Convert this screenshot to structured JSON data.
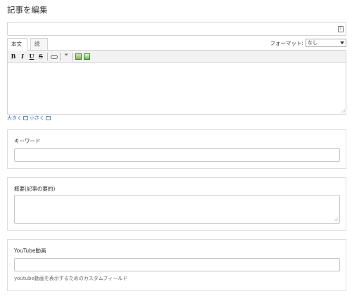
{
  "page": {
    "title": "記事を編集"
  },
  "title_field": {
    "value": "",
    "icon": "field-menu-icon"
  },
  "editor": {
    "tabs": [
      {
        "label": "本文",
        "active": true
      },
      {
        "label": "続き",
        "active": false
      }
    ],
    "format_label": "フォーマット:",
    "format_value": "なし",
    "toolbar": {
      "bold": "B",
      "italic": "I",
      "underline": "U",
      "strike": "S",
      "quote": "“"
    },
    "body_value": "",
    "size_links": {
      "larger": "大きく",
      "smaller": "小さく"
    }
  },
  "keyword_box": {
    "label": "キーワード",
    "value": ""
  },
  "summary_box": {
    "label": "概要(記事の要約)",
    "value": ""
  },
  "youtube_box": {
    "label": "YouTube動画",
    "value": "",
    "hint": "youtube動画を表示するためのカスタムフィールド"
  },
  "colors": {
    "link": "#2a6fb3",
    "border": "#d4d4d4",
    "toolbar_bg": "#f2f2f2"
  }
}
